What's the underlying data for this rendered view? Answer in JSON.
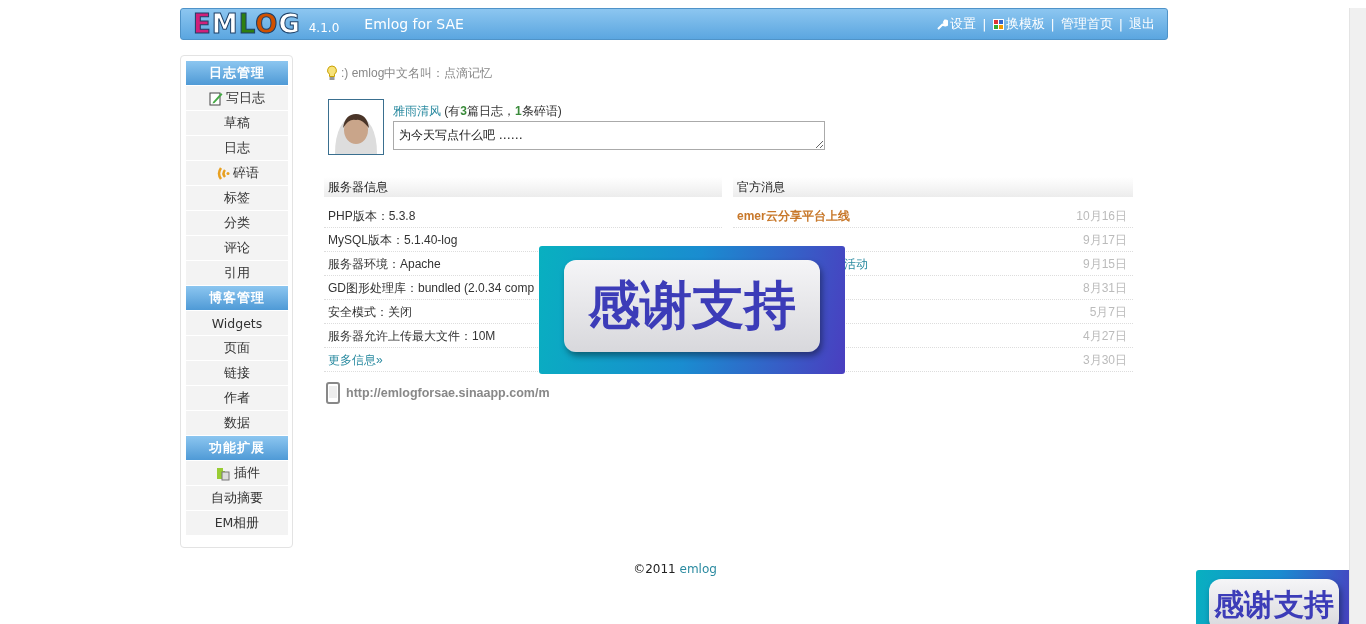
{
  "header": {
    "logo": "EMLOG",
    "version": "4.1.0",
    "site_title": "Emlog for SAE",
    "separator": "|",
    "links": [
      {
        "label": "设置",
        "kind": "wrench"
      },
      {
        "label": "换模板",
        "kind": "grid"
      },
      {
        "label": "管理首页",
        "kind": "plain"
      },
      {
        "label": "退出",
        "kind": "plain"
      }
    ]
  },
  "sidebar": {
    "sections": [
      {
        "title": "日志管理",
        "items": [
          {
            "label": "写日志",
            "kind": "pencil"
          },
          {
            "label": "草稿"
          },
          {
            "label": "日志"
          },
          {
            "label": "碎语",
            "kind": "signal"
          },
          {
            "label": "标签"
          },
          {
            "label": "分类"
          },
          {
            "label": "评论"
          },
          {
            "label": "引用"
          }
        ]
      },
      {
        "title": "博客管理",
        "items": [
          {
            "label": "Widgets"
          },
          {
            "label": "页面"
          },
          {
            "label": "链接"
          },
          {
            "label": "作者"
          },
          {
            "label": "数据"
          }
        ]
      },
      {
        "title": "功能扩展",
        "items": [
          {
            "label": "插件",
            "kind": "puzzle"
          },
          {
            "label": "自动摘要"
          },
          {
            "label": "EM相册"
          }
        ]
      }
    ]
  },
  "tip": ":) emlog中文名叫：点滴记忆",
  "profile": {
    "name": "雅雨清风",
    "stats": "(有**3**篇日志，**1**条碎语)",
    "status_value": "为今天写点什么吧 ……"
  },
  "server_info": {
    "title": "服务器信息",
    "rows": [
      "PHP版本：5.3.8",
      "MySQL版本：5.1.40-log",
      "服务器环境：Apache",
      "GD图形处理库：bundled (2.0.34 comp",
      "安全模式：关闭",
      "服务器允许上传最大文件：10M"
    ],
    "more_link": "更多信息»"
  },
  "news": {
    "title": "官方消息",
    "items": [
      {
        "title": "emer云分享平台上线",
        "highlight": true,
        "covered": false,
        "date": "10月16日"
      },
      {
        "date": "9月17日"
      },
      {
        "title": "活动",
        "highlight": false,
        "covered": true,
        "date": "9月15日"
      },
      {
        "date": "8月31日"
      },
      {
        "date": "5月7日"
      },
      {
        "date": "4月27日"
      },
      {
        "date": "3月30日"
      }
    ]
  },
  "mobile_url": "http://emlogforsae.sinaapp.com/m",
  "footer": {
    "copyright": "©2011",
    "link": "emlog"
  },
  "banners": [
    {
      "text": "感谢支持"
    },
    {
      "text": "感谢支持"
    }
  ]
}
